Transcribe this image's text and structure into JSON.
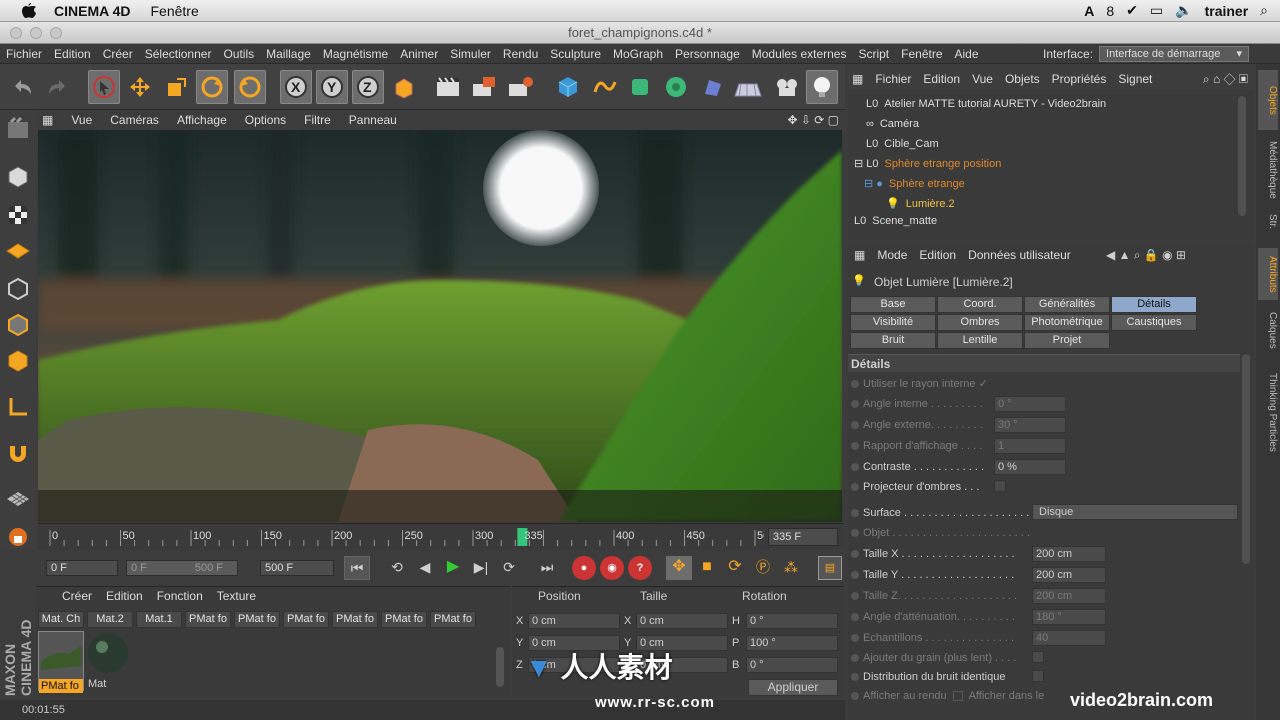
{
  "os_menubar": {
    "app": "CINEMA 4D",
    "menu": "Fenêtre",
    "badge": "8",
    "user": "trainer"
  },
  "window": {
    "title": "foret_champignons.c4d *"
  },
  "menu": [
    "Fichier",
    "Edition",
    "Créer",
    "Sélectionner",
    "Outils",
    "Maillage",
    "Magnétisme",
    "Animer",
    "Simuler",
    "Rendu",
    "Sculpture",
    "MoGraph",
    "Personnage",
    "Modules externes",
    "Script",
    "Fenêtre",
    "Aide"
  ],
  "interface": {
    "label": "Interface:",
    "value": "Interface de démarrage"
  },
  "viewport_menu": [
    "Vue",
    "Caméras",
    "Affichage",
    "Options",
    "Filtre",
    "Panneau"
  ],
  "timeline": {
    "ticks": [
      "0",
      "50",
      "100",
      "150",
      "200",
      "250",
      "300",
      "335",
      "400",
      "450",
      "500"
    ],
    "current": "335",
    "frame_field": "335 F"
  },
  "transport": {
    "start": "0 F",
    "range_start": "0 F",
    "range_end": "500 F",
    "end": "500 F"
  },
  "materials": {
    "menu": [
      "Créer",
      "Edition",
      "Fonction",
      "Texture"
    ],
    "tabs": [
      "Mat. Ch",
      "Mat.2",
      "Mat.1",
      "PMat fo",
      "PMat fo",
      "PMat fo",
      "PMat fo",
      "PMat fo",
      "PMat fo"
    ],
    "items": [
      {
        "label": "PMat fo"
      },
      {
        "label": "Mat"
      }
    ]
  },
  "coords": {
    "headers": [
      "Position",
      "Taille",
      "Rotation"
    ],
    "rows": [
      {
        "a": "X",
        "v1": "0 cm",
        "b": "X",
        "v2": "0 cm",
        "c": "H",
        "v3": "0 °"
      },
      {
        "a": "Y",
        "v1": "0 cm",
        "b": "Y",
        "v2": "0 cm",
        "c": "P",
        "v3": "100 °"
      },
      {
        "a": "Z",
        "v1": "0 cm",
        "b": "Z",
        "v2": "0 cm",
        "c": "B",
        "v3": "0 °"
      }
    ],
    "apply": "Appliquer"
  },
  "status": {
    "time": "00:01:55"
  },
  "object_manager": {
    "menu": [
      "Fichier",
      "Edition",
      "Vue",
      "Objets",
      "Propriétés",
      "Signet"
    ],
    "rows": [
      {
        "name": "Atelier MATTE tutorial AURETY - Video2brain",
        "color": "#dddddd"
      },
      {
        "name": "Caméra",
        "color": "#dddddd"
      },
      {
        "name": "Cible_Cam",
        "color": "#dddddd"
      },
      {
        "name": "Sphère etrange position",
        "color": "#e08a2e"
      },
      {
        "name": "Sphère etrange",
        "color": "#e08a2e"
      },
      {
        "name": "Lumière.2",
        "color": "#f0c040"
      },
      {
        "name": "Scene_matte",
        "color": "#dddddd"
      }
    ]
  },
  "attributes": {
    "menu": [
      "Mode",
      "Edition",
      "Données utilisateur"
    ],
    "object": "Objet Lumière [Lumière.2]",
    "tabs": [
      "Base",
      "Coord.",
      "Généralités",
      "Détails",
      "Visibilité",
      "Ombres",
      "Photométrique",
      "Caustiques",
      "Bruit",
      "Lentille",
      "Projet"
    ],
    "section": "Détails",
    "rows": [
      {
        "label": "Utiliser le rayon interne",
        "value": "✓",
        "dim": true
      },
      {
        "label": "Angle interne . . . . . . . . .",
        "value": "0 °",
        "dim": true
      },
      {
        "label": "Angle externe. . . . . . . . .",
        "value": "30 °",
        "dim": true
      },
      {
        "label": "Rapport d'affichage . . . .",
        "value": "1",
        "dim": true
      },
      {
        "label": "Contraste . . . . . . . . . . . .",
        "value": "0 %",
        "dim": false
      },
      {
        "label": "Projecteur d'ombres . . .",
        "value": "",
        "dim": false
      },
      {
        "label": "Surface . . . . . . . . . . . . . . . . . . . . .",
        "value": "Disque",
        "dim": false
      },
      {
        "label": "Objet . . . . . . . . . . . . . . . . . . . . . . .",
        "value": "",
        "dim": true
      },
      {
        "label": "Taille X . . . . . . . . . . . . . . . . . . .",
        "value": "200 cm",
        "dim": false
      },
      {
        "label": "Taille Y . . . . . . . . . . . . . . . . . . .",
        "value": "200 cm",
        "dim": false
      },
      {
        "label": "Taille Z. . . . . . . . . . . . . . . . . . . .",
        "value": "200 cm",
        "dim": true
      },
      {
        "label": "Angle d'atténuation. . . . . . . . . .",
        "value": "180 °",
        "dim": true
      },
      {
        "label": "Echantillons . . . . . . . . . . . . . . .",
        "value": "40",
        "dim": true
      },
      {
        "label": "Ajouter du grain (plus lent) . . . .",
        "value": "",
        "dim": true
      },
      {
        "label": "Distribution du bruit identique",
        "value": "",
        "dim": false
      },
      {
        "label": "Afficher au rendu",
        "value": "Afficher dans le",
        "dim": true
      }
    ]
  },
  "right_tabs": [
    "Objets",
    "Médiathèque",
    "Str.",
    "Attributs",
    "Calques",
    "Thinking Particles"
  ],
  "watermark": {
    "brand": "video2brain.com",
    "cn": "人人素材",
    "url": "www.rr-sc.com"
  },
  "maxon": "MAXON CINEMA 4D",
  "colors": {
    "accent_tab": "#8ea8cc",
    "play": "#33cc33",
    "keyframe": "#34c47c"
  }
}
